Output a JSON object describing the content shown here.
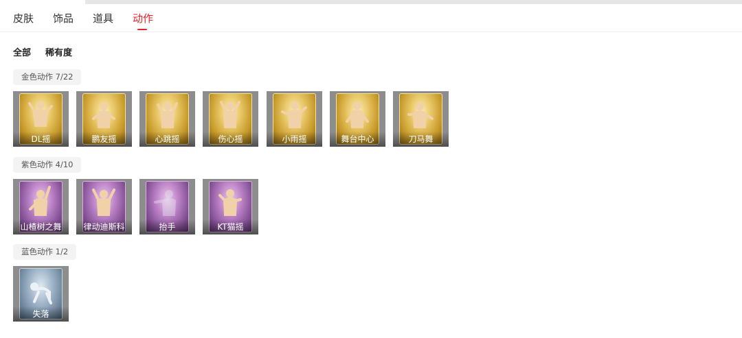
{
  "tabs": [
    {
      "label": "皮肤"
    },
    {
      "label": "饰品"
    },
    {
      "label": "道具"
    },
    {
      "label": "动作",
      "active": true
    }
  ],
  "filters": [
    {
      "label": "全部"
    },
    {
      "label": "稀有度"
    }
  ],
  "sections": [
    {
      "title": "金色动作 7/22",
      "rarity_color": "#d4a93a",
      "items": [
        {
          "label": "DL摇"
        },
        {
          "label": "鹏友摇"
        },
        {
          "label": "心跳摇"
        },
        {
          "label": "伤心摇"
        },
        {
          "label": "小雨摇"
        },
        {
          "label": "舞台中心"
        },
        {
          "label": "刀马舞"
        }
      ]
    },
    {
      "title": "紫色动作 4/10",
      "rarity_color": "#a66fb5",
      "items": [
        {
          "label": "山楂树之舞"
        },
        {
          "label": "律动迪斯科"
        },
        {
          "label": "抬手"
        },
        {
          "label": "KT猫摇"
        }
      ]
    },
    {
      "title": "蓝色动作 1/2",
      "rarity_color": "#7f97ad",
      "items": [
        {
          "label": "失落"
        }
      ]
    }
  ],
  "colors": {
    "accent": "#e0222b",
    "figure": "#f1d2a8"
  }
}
